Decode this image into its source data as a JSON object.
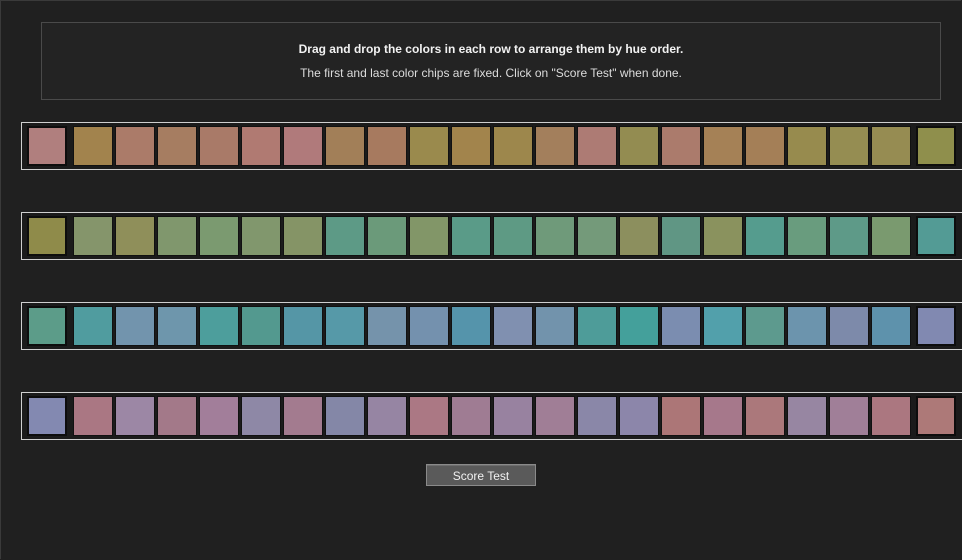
{
  "instructions": {
    "line1": "Drag and drop the colors in each row to arrange them by hue order.",
    "line2": "The first and last color chips are fixed. Click on \"Score Test\" when done."
  },
  "score_button_label": "Score Test",
  "rows": [
    {
      "first": "#b07f7e",
      "chips": [
        "#a2834d",
        "#ab7b69",
        "#a67d61",
        "#a97a68",
        "#b07a72",
        "#b07a7b",
        "#a27f58",
        "#a77a5f",
        "#9a8a4d",
        "#a2844c",
        "#9d874c",
        "#a37f5c",
        "#ad7b74",
        "#938c51",
        "#ab7b6c",
        "#a58156",
        "#a47f57",
        "#978b4e",
        "#958d52",
        "#968c52"
      ],
      "last": "#8f8f4c"
    },
    {
      "first": "#8f8b4a",
      "chips": [
        "#85956b",
        "#8f8f5a",
        "#80976d",
        "#7b9a70",
        "#81976d",
        "#859466",
        "#5d9a86",
        "#6b9a7a",
        "#829668",
        "#5a9b88",
        "#5e9a84",
        "#6f9a7a",
        "#749a7a",
        "#8c8f5e",
        "#609684",
        "#8a925e",
        "#559c8e",
        "#699c7e",
        "#5e9a88",
        "#7a9a6f"
      ],
      "last": "#539b95"
    },
    {
      "first": "#5c9c89",
      "chips": [
        "#509c9f",
        "#7294ad",
        "#6e96ac",
        "#4d9e9c",
        "#53998f",
        "#5596a6",
        "#5699a8",
        "#7593ab",
        "#7491ae",
        "#5594ab",
        "#8090b0",
        "#7293ac",
        "#4e9c99",
        "#44a09b",
        "#7b8db0",
        "#52a0ab",
        "#5d9a8e",
        "#6c94ad",
        "#7d8aaa",
        "#5e92ac"
      ],
      "last": "#8189b1"
    },
    {
      "first": "#8389b1",
      "chips": [
        "#aa7783",
        "#9c87a5",
        "#a37989",
        "#a27e9a",
        "#8e88a6",
        "#a37b8f",
        "#8487a7",
        "#9685a3",
        "#ab7884",
        "#9f7c93",
        "#9882a0",
        "#a07e96",
        "#8a87a8",
        "#8c86aa",
        "#ac7677",
        "#a6788b",
        "#ab787b",
        "#9786a2",
        "#a07f98",
        "#ab7780"
      ],
      "last": "#ad7978"
    }
  ]
}
